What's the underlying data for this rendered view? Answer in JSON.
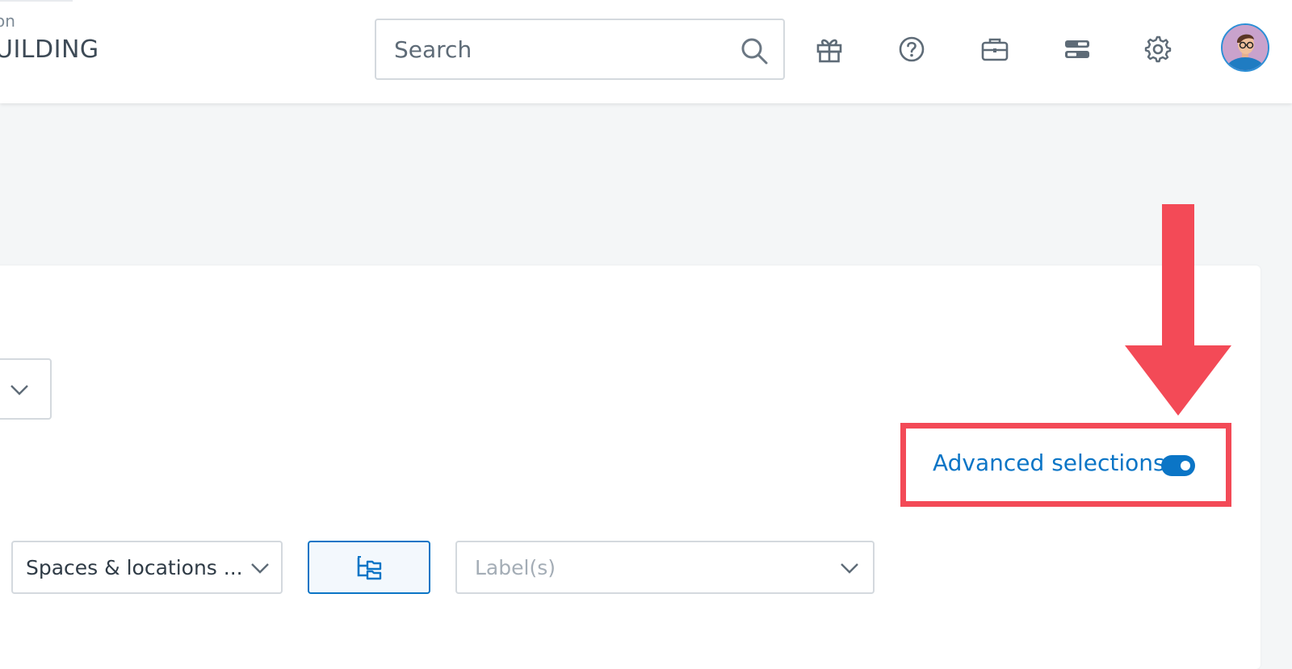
{
  "header": {
    "brand_sub": "on",
    "brand_main": "UILDING",
    "search": {
      "placeholder": "Search"
    },
    "icons": [
      "gift-icon",
      "help-icon",
      "briefcase-icon",
      "server-icon",
      "gear-icon"
    ],
    "avatar": "user-avatar"
  },
  "filters": {
    "advanced_selections_label": "Advanced selections",
    "advanced_selections_enabled": true,
    "spaces_select_value": "Spaces & locations ...",
    "labels_placeholder": "Label(s)"
  },
  "colors": {
    "accent": "#0b75c6",
    "highlight": "#f34a57",
    "page_bg": "#f4f6f7"
  }
}
